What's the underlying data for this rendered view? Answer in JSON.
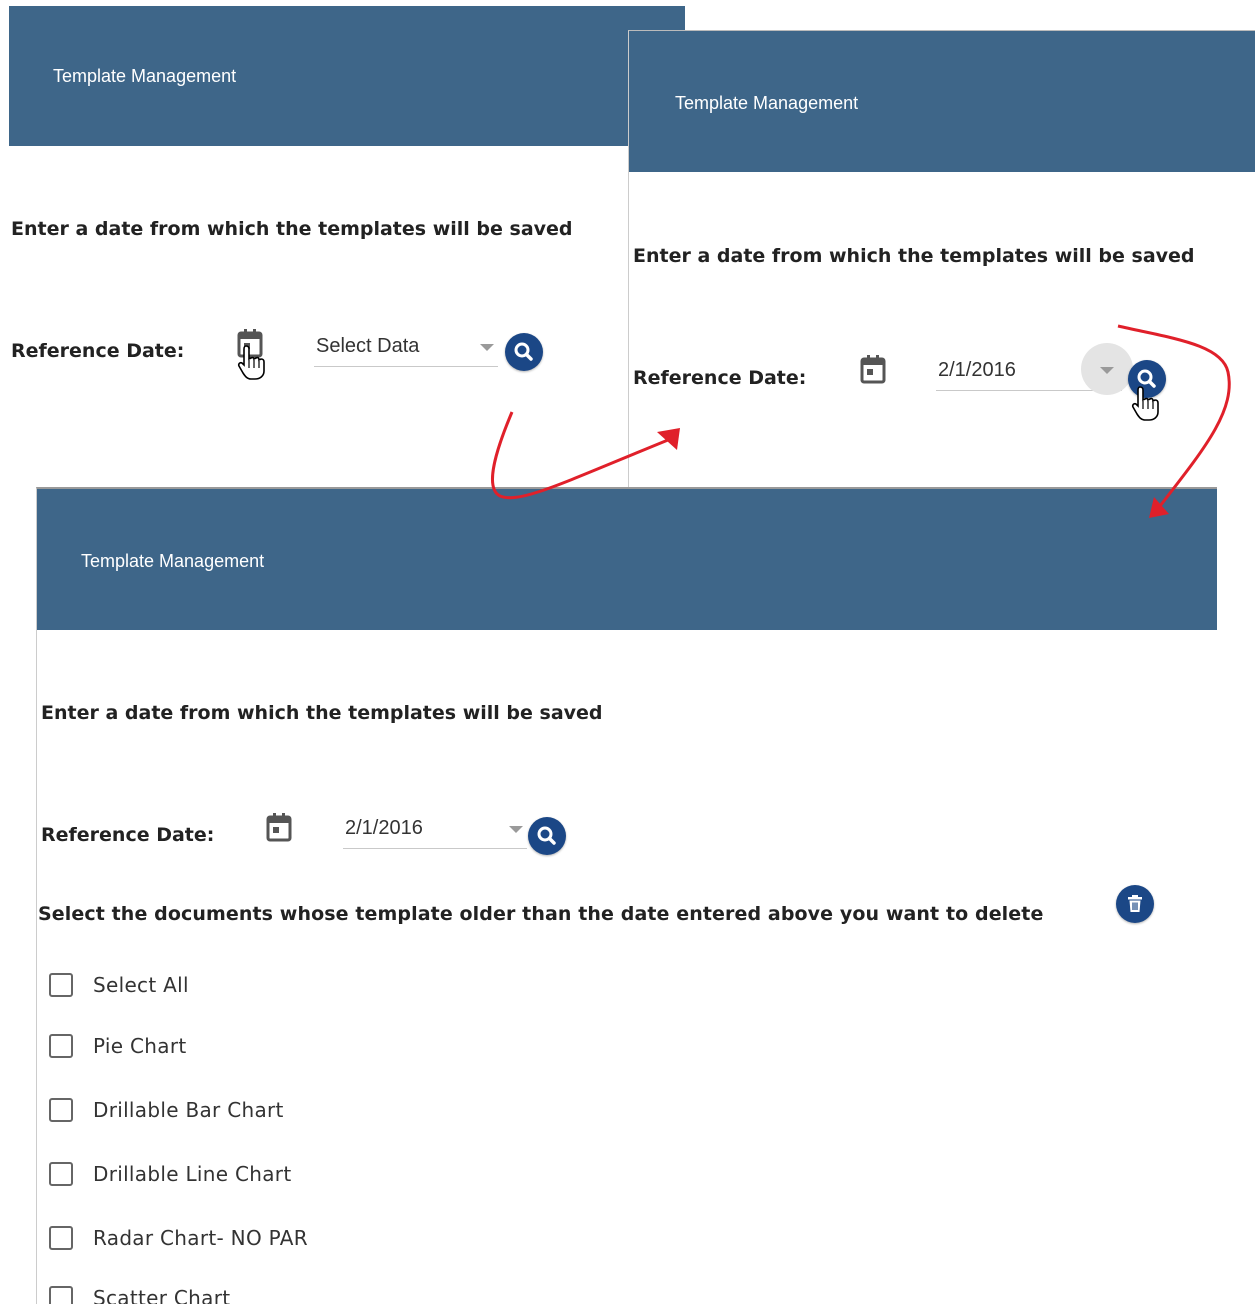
{
  "panels": {
    "first": {
      "header_title": "Template Management",
      "prompt": "Enter a date from which the templates will be saved",
      "reference_label": "Reference Date:",
      "date_placeholder": "Select Data"
    },
    "second": {
      "header_title": "Template Management",
      "prompt": "Enter a date from which the templates will be saved",
      "reference_label": "Reference Date:",
      "date_value": "2/1/2016"
    },
    "third": {
      "header_title": "Template Management",
      "prompt": "Enter a date from which the templates will be saved",
      "reference_label": "Reference Date:",
      "date_value": "2/1/2016",
      "delete_prompt": "Select the documents whose template older than the date entered above you want to delete",
      "documents": [
        "Select All",
        "Pie Chart",
        "Drillable Bar Chart",
        "Drillable Line Chart",
        "Radar Chart- NO PAR",
        "Scatter Chart"
      ]
    }
  },
  "icons": {
    "calendar": "calendar-icon",
    "search": "search-icon",
    "delete": "trash-icon",
    "dropdown": "chevron-down-icon",
    "cursor": "hand-pointer-icon",
    "flow_arrow": "arrow-icon"
  },
  "colors": {
    "header": "#3e6689",
    "button": "#1b4786",
    "arrow": "#e0202a"
  }
}
